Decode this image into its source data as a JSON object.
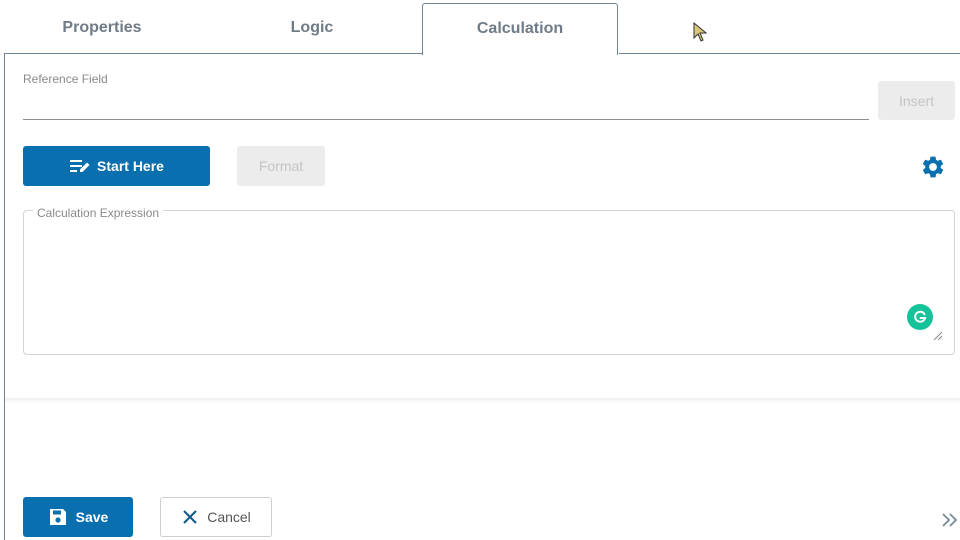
{
  "tabs": [
    {
      "label": "Properties",
      "active": false
    },
    {
      "label": "Logic",
      "active": false
    },
    {
      "label": "Calculation",
      "active": true
    }
  ],
  "reference_field": {
    "label": "Reference Field",
    "value": "",
    "insert_label": "Insert"
  },
  "toolbar": {
    "start_label": "Start Here",
    "format_label": "Format",
    "settings_icon": "gear-icon"
  },
  "calculation": {
    "label": "Calculation Expression",
    "value": ""
  },
  "footer": {
    "save_label": "Save",
    "cancel_label": "Cancel"
  },
  "colors": {
    "primary": "#0a6fae",
    "disabled_bg": "#ececec",
    "grammarly": "#15c39a",
    "tab_border": "#6f8596"
  }
}
